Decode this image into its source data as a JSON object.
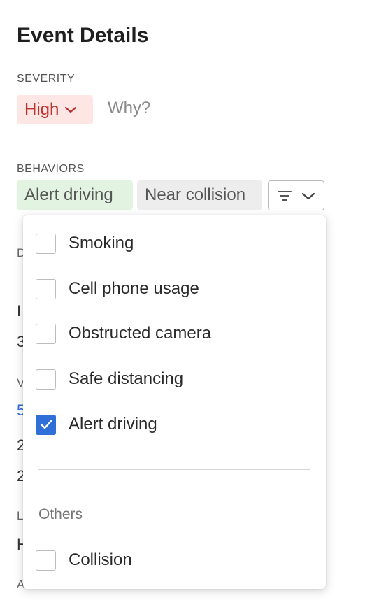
{
  "page": {
    "title": "Event Details"
  },
  "severity": {
    "label": "SEVERITY",
    "value": "High",
    "why_link": "Why?"
  },
  "behaviors": {
    "label": "BEHAVIORS",
    "tags": [
      "Alert driving",
      "Near collision"
    ]
  },
  "background_peek": [
    "D",
    "I",
    "3",
    "V",
    "5",
    "2",
    "2",
    "L",
    "H",
    "A"
  ],
  "dropdown": {
    "options": [
      {
        "label": "Smoking",
        "checked": false
      },
      {
        "label": "Cell phone usage",
        "checked": false
      },
      {
        "label": "Obstructed camera",
        "checked": false
      },
      {
        "label": "Safe distancing",
        "checked": false
      },
      {
        "label": "Alert driving",
        "checked": true
      }
    ],
    "group_label": "Others",
    "other_options": [
      {
        "label": "Collision",
        "checked": false
      }
    ]
  },
  "colors": {
    "severity_bg": "#fde6e4",
    "severity_text": "#c0302b",
    "alert_tag_bg": "#e3f3e2",
    "neutral_tag_bg": "#ededed",
    "checkbox_checked": "#2e6fd8"
  }
}
